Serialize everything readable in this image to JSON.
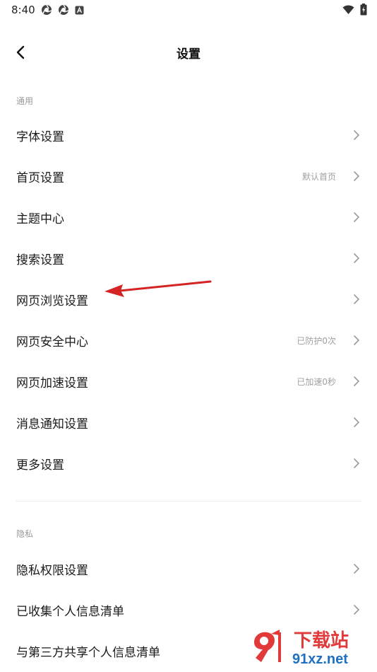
{
  "status_bar": {
    "time": "8:40"
  },
  "header": {
    "title": "设置"
  },
  "sections": {
    "general_label": "通用",
    "privacy_label": "隐私"
  },
  "general_items": [
    {
      "label": "字体设置",
      "value": ""
    },
    {
      "label": "首页设置",
      "value": "默认首页"
    },
    {
      "label": "主题中心",
      "value": ""
    },
    {
      "label": "搜索设置",
      "value": ""
    },
    {
      "label": "网页浏览设置",
      "value": ""
    },
    {
      "label": "网页安全中心",
      "value": "已防护0次"
    },
    {
      "label": "网页加速设置",
      "value": "已加速0秒"
    },
    {
      "label": "消息通知设置",
      "value": ""
    },
    {
      "label": "更多设置",
      "value": ""
    }
  ],
  "privacy_items": [
    {
      "label": "隐私权限设置",
      "value": ""
    },
    {
      "label": "已收集个人信息清单",
      "value": ""
    },
    {
      "label": "与第三方共享个人信息清单",
      "value": ""
    }
  ],
  "watermark": {
    "logo_text": "下载站",
    "url_text": "91xz.net"
  },
  "colors": {
    "annotation_arrow": "#d42424",
    "watermark_red": "#e23a3a",
    "watermark_blue": "#1f6fc4"
  },
  "icons": [
    "chrome-icon",
    "chrome-icon",
    "app-icon",
    "wifi-icon",
    "battery-icon",
    "back-arrow-icon",
    "chevron-right-icon"
  ]
}
